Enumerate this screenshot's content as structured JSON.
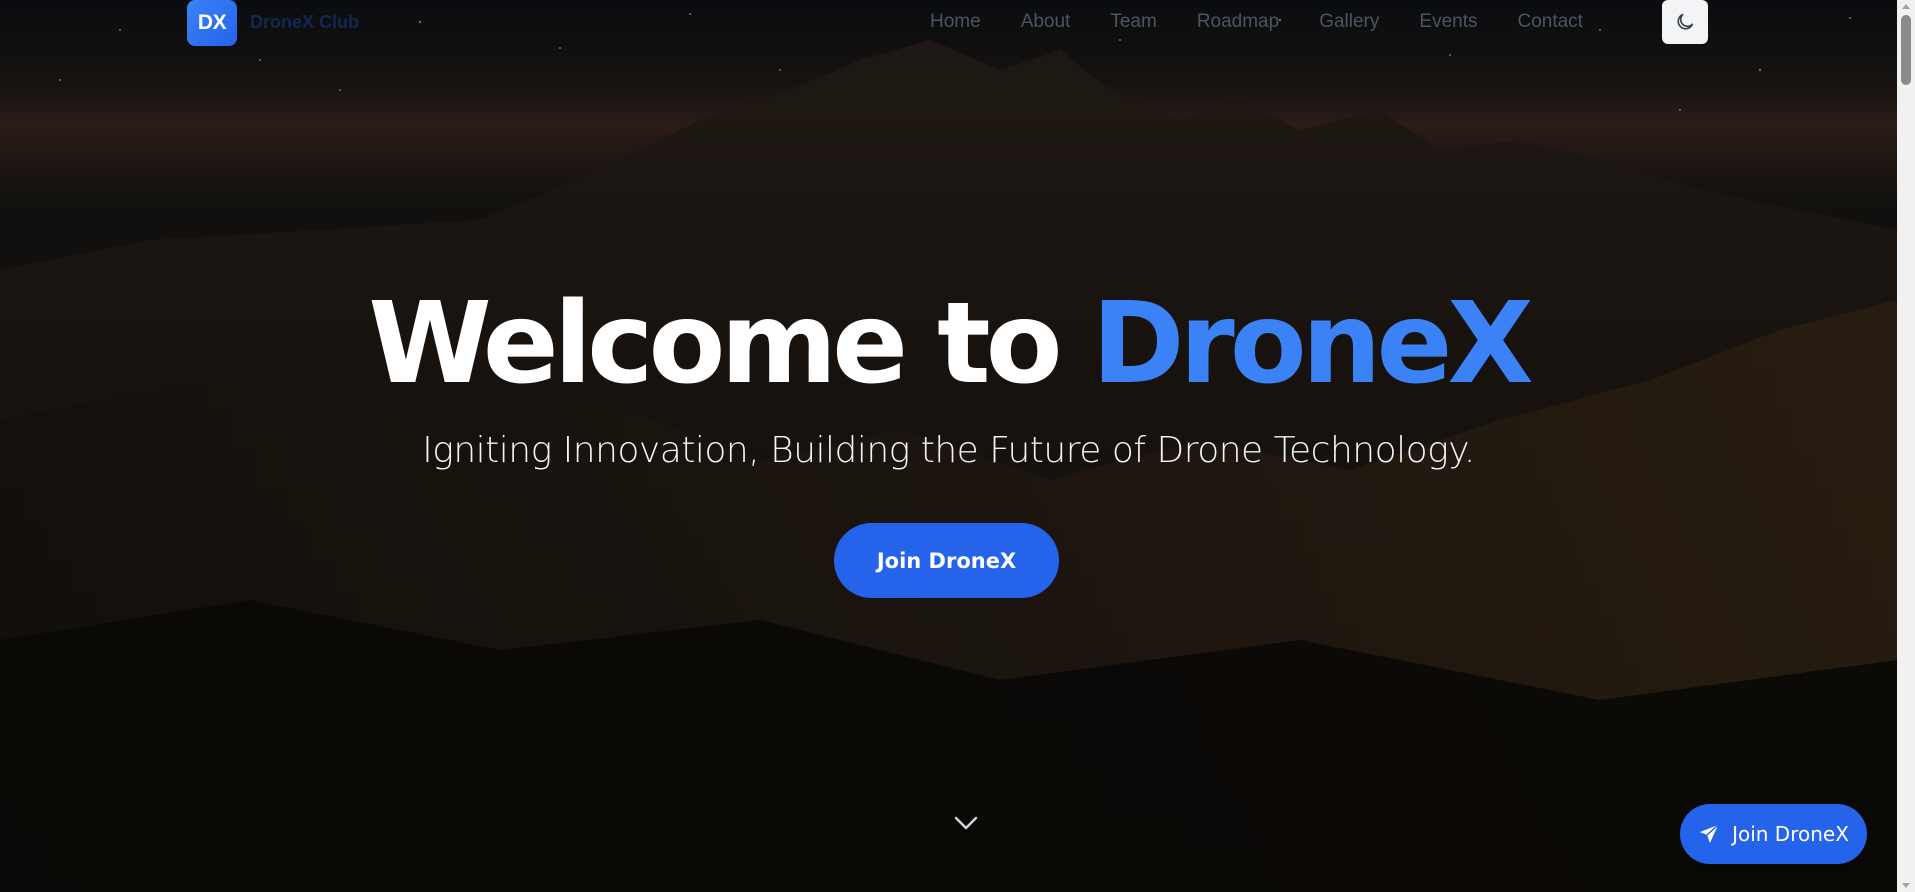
{
  "nav": {
    "logo": "DX",
    "brand": "DroneX Club",
    "links": [
      "Home",
      "About",
      "Team",
      "Roadmap",
      "Gallery",
      "Events",
      "Contact"
    ],
    "theme_icon": "moon-icon"
  },
  "hero": {
    "title_prefix": "Welcome to ",
    "title_accent": "DroneX",
    "subtitle": "Igniting Innovation, Building the Future of Drone Technology.",
    "cta_label": "Join DroneX",
    "scroll_icon": "chevron-down-icon"
  },
  "floating_button": {
    "label": "Join DroneX",
    "icon": "paper-plane-icon"
  },
  "colors": {
    "accent": "#3b82f6",
    "button": "#2563eb",
    "text": "#ffffff"
  }
}
